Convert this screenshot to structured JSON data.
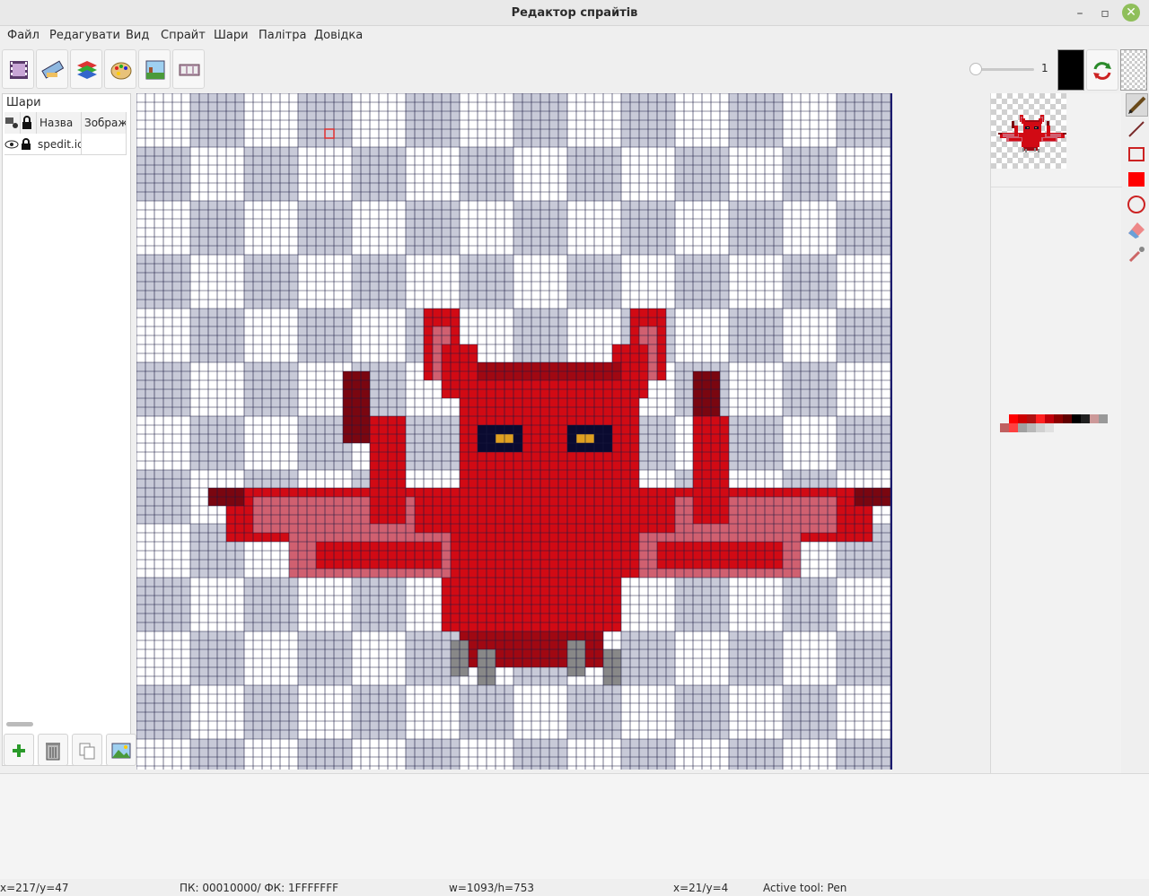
{
  "window": {
    "title": "Редактор спрайтів"
  },
  "menu": [
    "Файл",
    "Редагувати",
    "Вид",
    "Спрайт",
    "Шари",
    "Палітра",
    "Довідка"
  ],
  "toolbar": {
    "buttons": [
      "film-icon",
      "ruler-icon",
      "layers-icon",
      "palette-icon",
      "image-icon",
      "filmstrip-icon"
    ],
    "brush_size": "1",
    "primary_color": "#000000",
    "secondary_color": "transparent"
  },
  "layers_panel": {
    "title": "Шари",
    "columns": [
      "Назва",
      "Зображ"
    ],
    "rows": [
      {
        "name": "spedit.ic"
      }
    ],
    "buttons": [
      "add-layer-icon",
      "delete-layer-icon",
      "duplicate-layer-icon",
      "layer-image-icon"
    ]
  },
  "palette_colors": [
    "#ff0000",
    "#cc0000",
    "#b01010",
    "#ff2020",
    "#c0000a",
    "#8b0000",
    "#600000",
    "#000000",
    "#202020",
    "#cc9999",
    "#999999",
    "#c06060",
    "#ff4040",
    "#a0a0a0",
    "#b8b8b8",
    "#d0d0d0",
    "#e0e0e0"
  ],
  "status": {
    "cursor": "x=217/y=47",
    "colors": "ПК: 00010000/ ФК: 1FFFFFFF",
    "size": "w=1093/h=753",
    "pixel": "x=21/y=4",
    "active_tool": "Active tool: Pen"
  }
}
